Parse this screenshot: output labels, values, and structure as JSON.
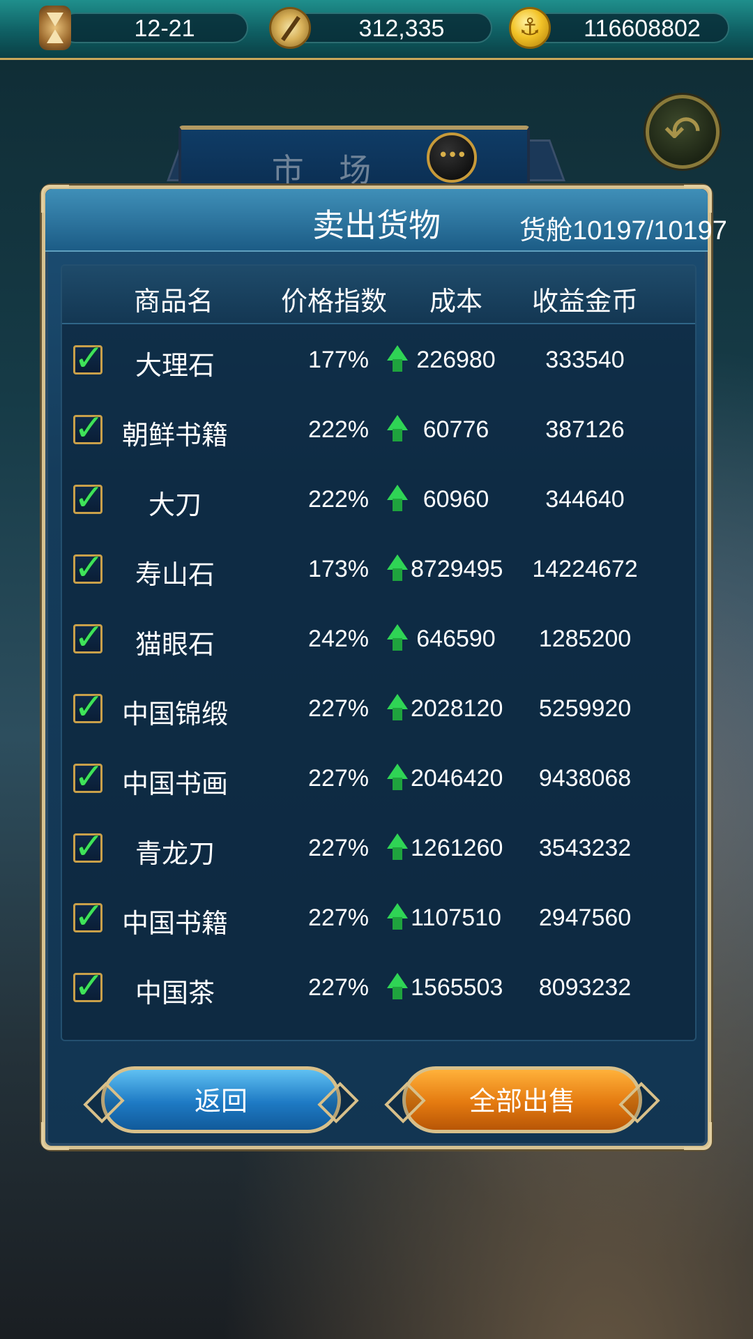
{
  "topbar": {
    "date": "12-21",
    "compass_value": "312,335",
    "gold_value": "116608802",
    "icons": [
      "hourglass-icon",
      "compass-icon",
      "anchor-coin-icon"
    ]
  },
  "market": {
    "title": "市 场",
    "chat_icon": "chat-bubble-icon"
  },
  "panel": {
    "title": "卖出货物",
    "hold_label": "货舱10197/10197"
  },
  "table": {
    "headers": {
      "name": "商品名",
      "price_index": "价格指数",
      "cost": "成本",
      "profit": "收益金币"
    },
    "rows": [
      {
        "name": "大理石",
        "price_index": "177%",
        "cost": "226980",
        "profit": "333540",
        "checked": true,
        "trend": "up"
      },
      {
        "name": "朝鲜书籍",
        "price_index": "222%",
        "cost": "60776",
        "profit": "387126",
        "checked": true,
        "trend": "up"
      },
      {
        "name": "大刀",
        "price_index": "222%",
        "cost": "60960",
        "profit": "344640",
        "checked": true,
        "trend": "up"
      },
      {
        "name": "寿山石",
        "price_index": "173%",
        "cost": "8729495",
        "profit": "14224672",
        "checked": true,
        "trend": "up"
      },
      {
        "name": "猫眼石",
        "price_index": "242%",
        "cost": "646590",
        "profit": "1285200",
        "checked": true,
        "trend": "up"
      },
      {
        "name": "中国锦缎",
        "price_index": "227%",
        "cost": "2028120",
        "profit": "5259920",
        "checked": true,
        "trend": "up"
      },
      {
        "name": "中国书画",
        "price_index": "227%",
        "cost": "2046420",
        "profit": "9438068",
        "checked": true,
        "trend": "up"
      },
      {
        "name": "青龙刀",
        "price_index": "227%",
        "cost": "1261260",
        "profit": "3543232",
        "checked": true,
        "trend": "up"
      },
      {
        "name": "中国书籍",
        "price_index": "227%",
        "cost": "1107510",
        "profit": "2947560",
        "checked": true,
        "trend": "up"
      },
      {
        "name": "中国茶",
        "price_index": "227%",
        "cost": "1565503",
        "profit": "8093232",
        "checked": true,
        "trend": "up"
      }
    ]
  },
  "buttons": {
    "back_label": "返回",
    "sell_all_label": "全部出售"
  },
  "colors": {
    "panel_border": "#d6c190",
    "check_green": "#3fe35a",
    "trend_up_green": "#2fd455",
    "back_button_blue": "#1e7ac4",
    "sell_button_orange": "#e47a10"
  }
}
